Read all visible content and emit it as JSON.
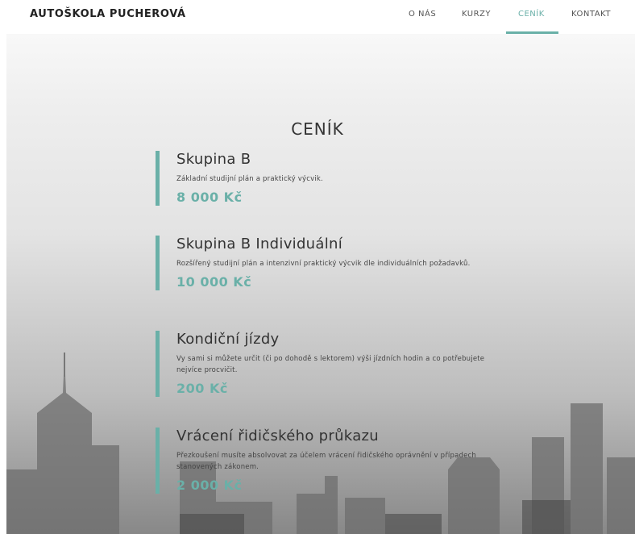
{
  "header": {
    "brand": "AUTOŠKOLA PUCHEROVÁ",
    "nav": [
      {
        "label": "O NÁS"
      },
      {
        "label": "KURZY"
      },
      {
        "label": "CENÍK"
      },
      {
        "label": "KONTAKT"
      }
    ],
    "active_nav": "CENÍK"
  },
  "pricing": {
    "title": "CENÍK",
    "items": [
      {
        "name": "Skupina B",
        "description": "Základní studijní plán a praktický výcvik.",
        "price": "8 000 Kč"
      },
      {
        "name": "Skupina B Individuální",
        "description": "Rozšířený studijní plán a intenzivní praktický výcvik dle individuálních požadavků.",
        "price": "10 000 Kč"
      },
      {
        "name": "Kondiční jízdy",
        "description": "Vy sami si můžete určit (či po dohodě s lektorem) výši jízdních hodin a co potřebujete nejvíce procvičit.",
        "price": "200 Kč"
      },
      {
        "name": "Vrácení řidičského průkazu",
        "description": "Přezkoušení musíte absolvovat za účelem vrácení řidičského oprávnění v případech stanovených zákonem.",
        "price": "2 000 Kč"
      }
    ]
  },
  "colors": {
    "accent": "#6ab0a8",
    "text": "#333333",
    "background": "#ffffff"
  }
}
